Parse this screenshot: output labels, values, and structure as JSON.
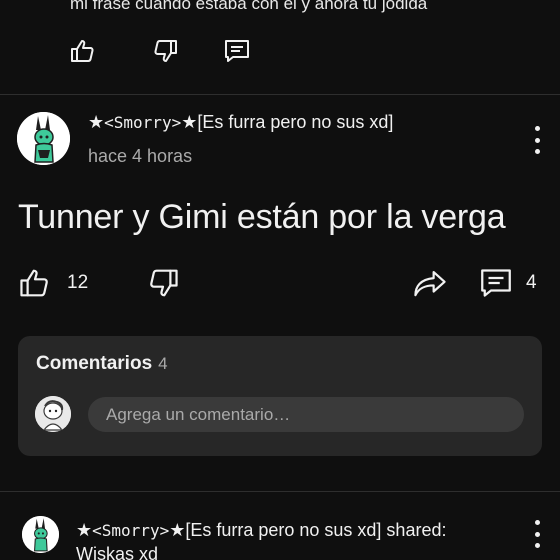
{
  "previous_post": {
    "text": "mi frase cuando estaba con el y ahora tu jodida",
    "like_icon": "thumbs-up-icon",
    "dislike_icon": "thumbs-down-icon",
    "comment_icon": "comment-icon"
  },
  "post": {
    "author_prefix": "★",
    "author_mono": "<Smorry>",
    "author_suffix": "★[Es furra pero no sus xd]",
    "time": "hace 4 horas",
    "text": "Tunner y Gimi están por la verga",
    "likes": "12",
    "comments": "4"
  },
  "comments_section": {
    "title": "Comentarios",
    "count": "4",
    "placeholder": "Agrega un comentario…"
  },
  "next_post": {
    "author_prefix": "★",
    "author_mono": "<Smorry>",
    "author_suffix": "★[Es furra pero no sus xd] shared:",
    "shared_title": "Wiskas xd"
  },
  "colors": {
    "background": "#0f0f0f",
    "card": "#272727",
    "text": "#f1f1f1",
    "muted": "#aaaaaa",
    "avatar_accent": "#3ec99a"
  }
}
